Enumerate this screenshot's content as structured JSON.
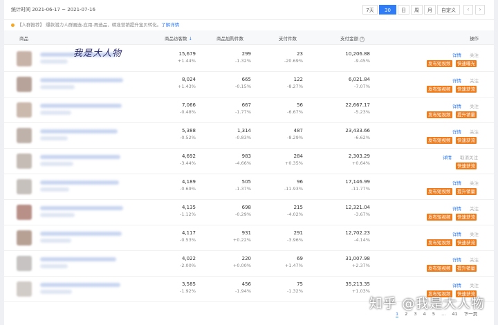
{
  "header": {
    "date_range": "统计时间 2021-06-17 ~ 2021-07-16",
    "range_buttons": [
      "7天",
      "30天",
      "日",
      "周",
      "月",
      "自定义"
    ],
    "prev": "‹",
    "next": "›"
  },
  "notice": {
    "text": "【人群推荐】 爆款潜力人群圈选-应用-再选品，精准营销提升宝贝转化。",
    "link": "了解详情"
  },
  "table": {
    "headers": [
      "商品",
      "商品访客数",
      "商品加购件数",
      "支付件数",
      "支付金额",
      "操作"
    ],
    "sort_icon": "↓",
    "info_icon": "?",
    "rows": [
      {
        "visitors": "15,679",
        "visitors_chg": "+1.44%",
        "cart": "299",
        "cart_chg": "-1.32%",
        "paid": "23",
        "paid_chg": "-20.69%",
        "amount": "10,206.88",
        "amount_chg": "-9.45%",
        "a1": "详情",
        "a2": "关注",
        "b1": "发布短视频",
        "b2": "快速曝光"
      },
      {
        "visitors": "8,024",
        "visitors_chg": "+1.43%",
        "cart": "665",
        "cart_chg": "-0.15%",
        "paid": "122",
        "paid_chg": "-8.27%",
        "amount": "6,021.84",
        "amount_chg": "-7.07%",
        "a1": "详情",
        "a2": "关注",
        "b1": "发布短视频",
        "b2": "快速获流"
      },
      {
        "visitors": "7,066",
        "visitors_chg": "-0.48%",
        "cart": "667",
        "cart_chg": "-1.77%",
        "paid": "56",
        "paid_chg": "-6.67%",
        "amount": "22,667.17",
        "amount_chg": "-5.23%",
        "a1": "详情",
        "a2": "关注",
        "b1": "发布短视频",
        "b2": "提升销量"
      },
      {
        "visitors": "5,388",
        "visitors_chg": "-0.52%",
        "cart": "1,314",
        "cart_chg": "-0.83%",
        "paid": "487",
        "paid_chg": "-8.29%",
        "amount": "23,433.66",
        "amount_chg": "-6.62%",
        "a1": "详情",
        "a2": "关注",
        "b1": "发布短视频",
        "b2": "快速获流"
      },
      {
        "visitors": "4,692",
        "visitors_chg": "-3.44%",
        "cart": "983",
        "cart_chg": "-4.66%",
        "paid": "284",
        "paid_chg": "+0.35%",
        "amount": "2,303.29",
        "amount_chg": "+0.64%",
        "a1": "详情",
        "a2": "取消关注",
        "b1": "",
        "b2": "快速获流"
      },
      {
        "visitors": "4,189",
        "visitors_chg": "-0.69%",
        "cart": "505",
        "cart_chg": "-1.37%",
        "paid": "96",
        "paid_chg": "-11.93%",
        "amount": "17,146.99",
        "amount_chg": "-11.77%",
        "a1": "详情",
        "a2": "关注",
        "b1": "发布短视频",
        "b2": "提升销量"
      },
      {
        "visitors": "4,135",
        "visitors_chg": "-1.12%",
        "cart": "698",
        "cart_chg": "-0.29%",
        "paid": "215",
        "paid_chg": "-4.02%",
        "amount": "12,321.04",
        "amount_chg": "-3.67%",
        "a1": "详情",
        "a2": "关注",
        "b1": "发布短视频",
        "b2": "快速获流"
      },
      {
        "visitors": "4,117",
        "visitors_chg": "-0.53%",
        "cart": "931",
        "cart_chg": "+0.22%",
        "paid": "291",
        "paid_chg": "-3.96%",
        "amount": "12,702.23",
        "amount_chg": "-4.14%",
        "a1": "详情",
        "a2": "关注",
        "b1": "发布短视频",
        "b2": "快速获流"
      },
      {
        "visitors": "4,022",
        "visitors_chg": "-2.00%",
        "cart": "220",
        "cart_chg": "+0.00%",
        "paid": "69",
        "paid_chg": "+1.47%",
        "amount": "31,007.98",
        "amount_chg": "+2.37%",
        "a1": "详情",
        "a2": "关注",
        "b1": "发布短视频",
        "b2": "提升销量"
      },
      {
        "visitors": "3,585",
        "visitors_chg": "-1.92%",
        "cart": "456",
        "cart_chg": "-1.94%",
        "paid": "75",
        "paid_chg": "-1.32%",
        "amount": "35,213.35",
        "amount_chg": "+1.03%",
        "a1": "详情",
        "a2": "关注",
        "b1": "发布短视频",
        "b2": "快速获流"
      }
    ]
  },
  "annotation": "我是大人物",
  "pagination": [
    "1",
    "2",
    "3",
    "4",
    "5",
    "...",
    "41",
    "下一页"
  ],
  "watermark": "知乎 @我是大人物",
  "colors": {
    "accent": "#2f7cf6",
    "action": "#f07b1a",
    "notice": "#f5a623"
  }
}
